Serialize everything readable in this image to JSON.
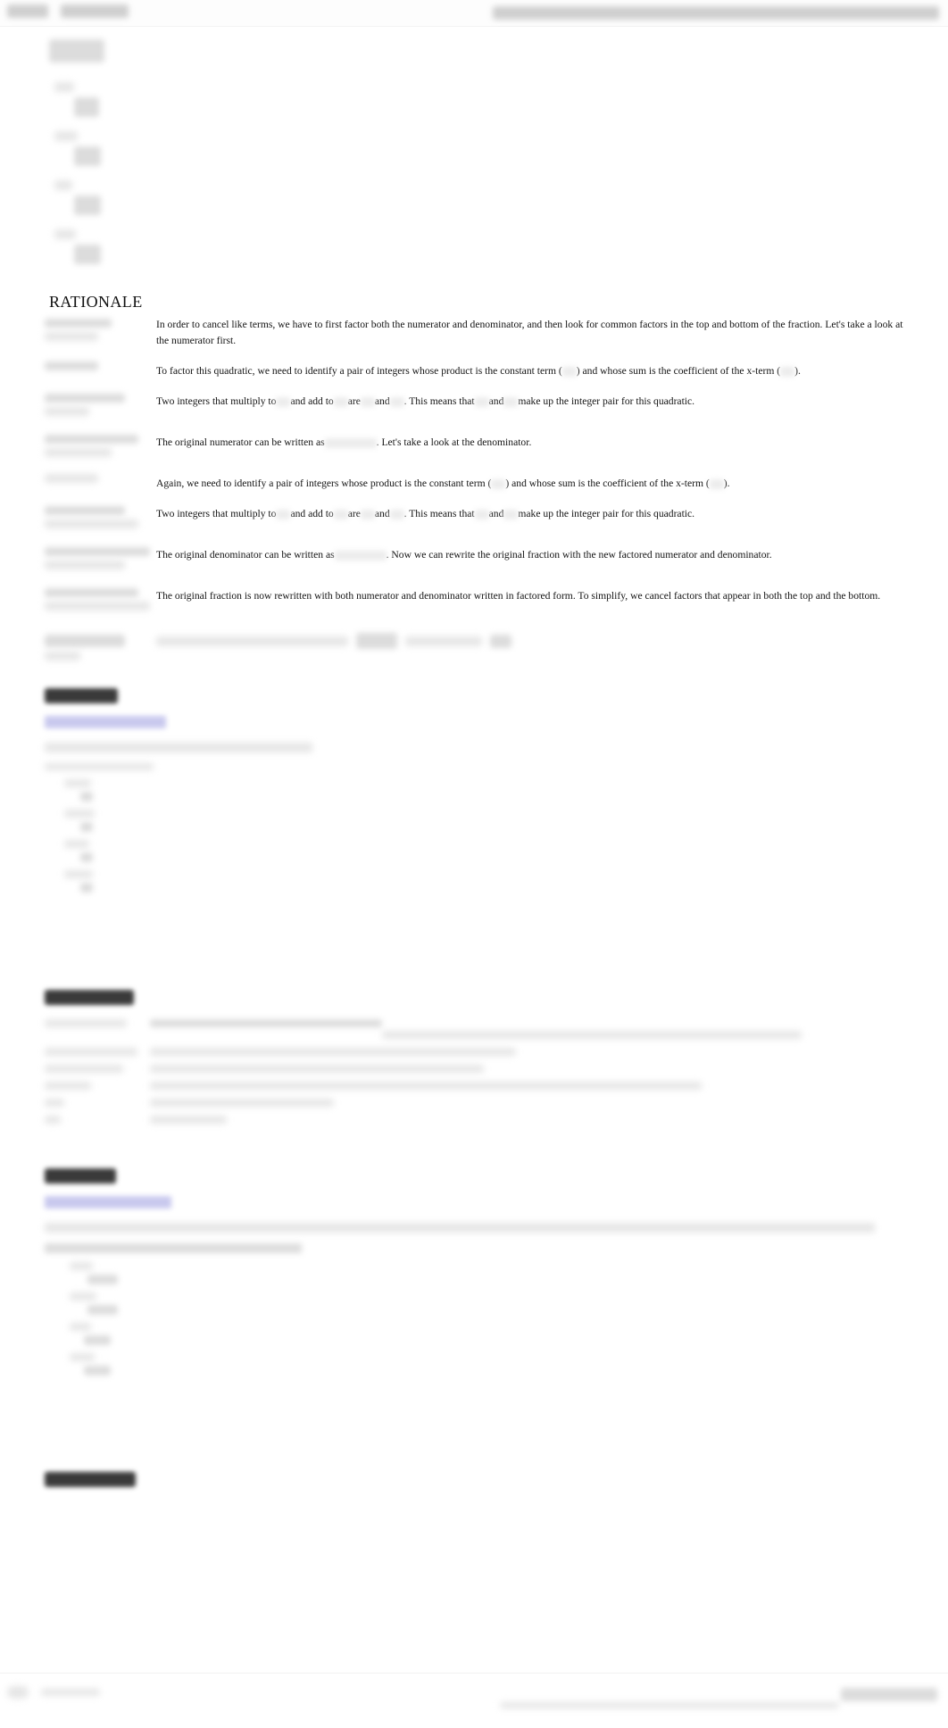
{
  "page": {
    "title": "RATIONALE",
    "colors": {
      "background": "#ffffff",
      "text": "#141414",
      "link_highlight": "#c9c9ee",
      "badge": "#3a3a3a",
      "redaction": "#cfcfcf"
    }
  },
  "topbar": {
    "left_items": [
      "redacted-app-name",
      "redacted-menu-item"
    ],
    "right_item": "redacted-url-string"
  },
  "choices": {
    "stem": "redacted-question-stem",
    "items": [
      {
        "letter": "redacted-letter-a",
        "formula": "redacted-formula-a"
      },
      {
        "letter": "redacted-letter-b",
        "formula": "redacted-formula-b"
      },
      {
        "letter": "redacted-letter-c",
        "formula": "redacted-formula-c"
      },
      {
        "letter": "redacted-letter-d",
        "formula": "redacted-formula-d"
      }
    ]
  },
  "rationale": {
    "heading": "RATIONALE",
    "paragraphs": [
      {
        "left": "redacted-expression-1",
        "text_before": "In order to cancel like terms, we have to first factor both the numerator and denominator, and then look for common factors in the top and bottom of the fraction. Let's take a look at the numerator first.",
        "text_after": ""
      },
      {
        "left": "redacted-expression-2",
        "text_before": "To factor this quadratic, we need to identify a pair of integers whose product is the constant term (",
        "text_mid": ") and whose sum is the coefficient of the x-term (",
        "text_after": ")."
      },
      {
        "left": "redacted-expression-3",
        "text_before": "Two integers that multiply to",
        "text_a": "and add to",
        "text_b": "are",
        "text_c": "and",
        "text_d": ". This means that",
        "text_e": "and",
        "text_f": "make up the integer pair for this quadratic."
      },
      {
        "left": "redacted-expression-4",
        "text_before": "The original numerator can be written as",
        "text_after": ". Let's take a look at the denominator."
      },
      {
        "left": "redacted-expression-5",
        "text_before": "Again, we need to identify a pair of integers whose product is the constant term (",
        "text_mid": ") and whose sum is the coefficient of the x-term (",
        "text_after": ")."
      },
      {
        "left": "redacted-expression-6",
        "text_before": "Two integers that multiply to",
        "text_a": "and add to",
        "text_b": "are",
        "text_c": "and",
        "text_d": ". This means that",
        "text_e": "and",
        "text_f": "make up the integer pair for this quadratic."
      },
      {
        "left": "redacted-expression-7",
        "text_before": "The original denominator can be written as",
        "text_after": ". Now we can rewrite the original fraction with the new factored numerator and denominator."
      },
      {
        "left": "redacted-expression-8",
        "text_before": "The original fraction is now rewritten with both numerator and denominator written in factored form. To simplify, we cancel factors that appear in both the top and the bottom.",
        "text_after": ""
      },
      {
        "left": "redacted-expression-9",
        "text_before": "redacted-final-sentence",
        "text_after": ""
      }
    ]
  },
  "sections": [
    {
      "badge": "redacted-section-badge-1",
      "link": "redacted-section-link-1",
      "lead": "redacted-lead-sentence-1",
      "subtext": "redacted-subtext-1",
      "options": [
        {
          "letter": "redacted-opt-letter",
          "value": "redacted-opt-value"
        },
        {
          "letter": "redacted-opt-letter",
          "value": "redacted-opt-value"
        },
        {
          "letter": "redacted-opt-letter",
          "value": "redacted-opt-value"
        },
        {
          "letter": "redacted-opt-letter",
          "value": "redacted-opt-value"
        }
      ]
    },
    {
      "badge": "redacted-section-badge-2",
      "lead": "redacted-lead-sentence-2",
      "definitions": [
        {
          "term": "redacted-term-1",
          "desc": "redacted-definition-1"
        },
        {
          "term": "redacted-term-2",
          "desc": "redacted-definition-2"
        },
        {
          "term": "redacted-term-3",
          "desc": "redacted-definition-3"
        },
        {
          "term": "redacted-term-4",
          "desc": "redacted-definition-4"
        },
        {
          "term": "redacted-term-5",
          "desc": "redacted-definition-5"
        },
        {
          "term": "redacted-term-6",
          "desc": "redacted-definition-6"
        }
      ]
    },
    {
      "badge": "redacted-section-badge-3",
      "link": "redacted-section-link-3",
      "lead": "redacted-lead-sentence-3",
      "subtext": "redacted-subtext-3",
      "options": [
        {
          "letter": "redacted-opt-letter",
          "value": "redacted-opt-value"
        },
        {
          "letter": "redacted-opt-letter",
          "value": "redacted-opt-value"
        },
        {
          "letter": "redacted-opt-letter",
          "value": "redacted-opt-value"
        },
        {
          "letter": "redacted-opt-letter",
          "value": "redacted-opt-value"
        }
      ]
    },
    {
      "badge": "redacted-section-badge-4"
    }
  ],
  "footer": {
    "left": "redacted-footer-left",
    "center": "redacted-footer-center",
    "right": "redacted-footer-right"
  }
}
